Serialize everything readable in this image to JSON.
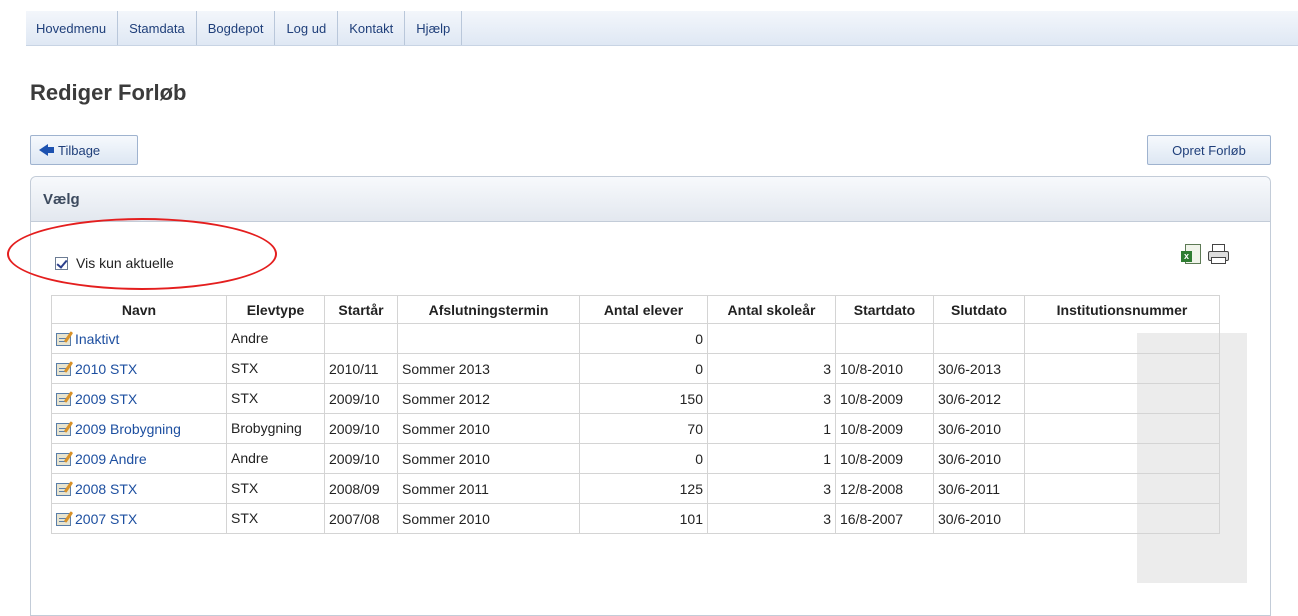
{
  "nav": [
    "Hovedmenu",
    "Stamdata",
    "Bogdepot",
    "Log ud",
    "Kontakt",
    "Hjælp"
  ],
  "page": {
    "title": "Rediger Forløb",
    "back_label": "Tilbage",
    "create_label": "Opret Forløb"
  },
  "panel": {
    "title": "Vælg",
    "filter_label": "Vis kun aktuelle",
    "filter_checked": true
  },
  "table": {
    "headers": [
      "Navn",
      "Elevtype",
      "Startår",
      "Afslutningstermin",
      "Antal elever",
      "Antal skoleår",
      "Startdato",
      "Slutdato",
      "Institutionsnummer"
    ],
    "rows": [
      {
        "name": "Inaktivt",
        "type": "Andre",
        "start": "",
        "term": "",
        "students": "0",
        "years": "",
        "startdate": "",
        "enddate": "",
        "inst": ""
      },
      {
        "name": "2010 STX",
        "type": "STX",
        "start": "2010/11",
        "term": "Sommer 2013",
        "students": "0",
        "years": "3",
        "startdate": "10/8-2010",
        "enddate": "30/6-2013",
        "inst": ""
      },
      {
        "name": "2009 STX",
        "type": "STX",
        "start": "2009/10",
        "term": "Sommer 2012",
        "students": "150",
        "years": "3",
        "startdate": "10/8-2009",
        "enddate": "30/6-2012",
        "inst": ""
      },
      {
        "name": "2009 Brobygning",
        "type": "Brobygning",
        "start": "2009/10",
        "term": "Sommer 2010",
        "students": "70",
        "years": "1",
        "startdate": "10/8-2009",
        "enddate": "30/6-2010",
        "inst": ""
      },
      {
        "name": "2009 Andre",
        "type": "Andre",
        "start": "2009/10",
        "term": "Sommer 2010",
        "students": "0",
        "years": "1",
        "startdate": "10/8-2009",
        "enddate": "30/6-2010",
        "inst": ""
      },
      {
        "name": "2008 STX",
        "type": "STX",
        "start": "2008/09",
        "term": "Sommer 2011",
        "students": "125",
        "years": "3",
        "startdate": "12/8-2008",
        "enddate": "30/6-2011",
        "inst": ""
      },
      {
        "name": "2007 STX",
        "type": "STX",
        "start": "2007/08",
        "term": "Sommer 2010",
        "students": "101",
        "years": "3",
        "startdate": "16/8-2007",
        "enddate": "30/6-2010",
        "inst": ""
      }
    ]
  }
}
